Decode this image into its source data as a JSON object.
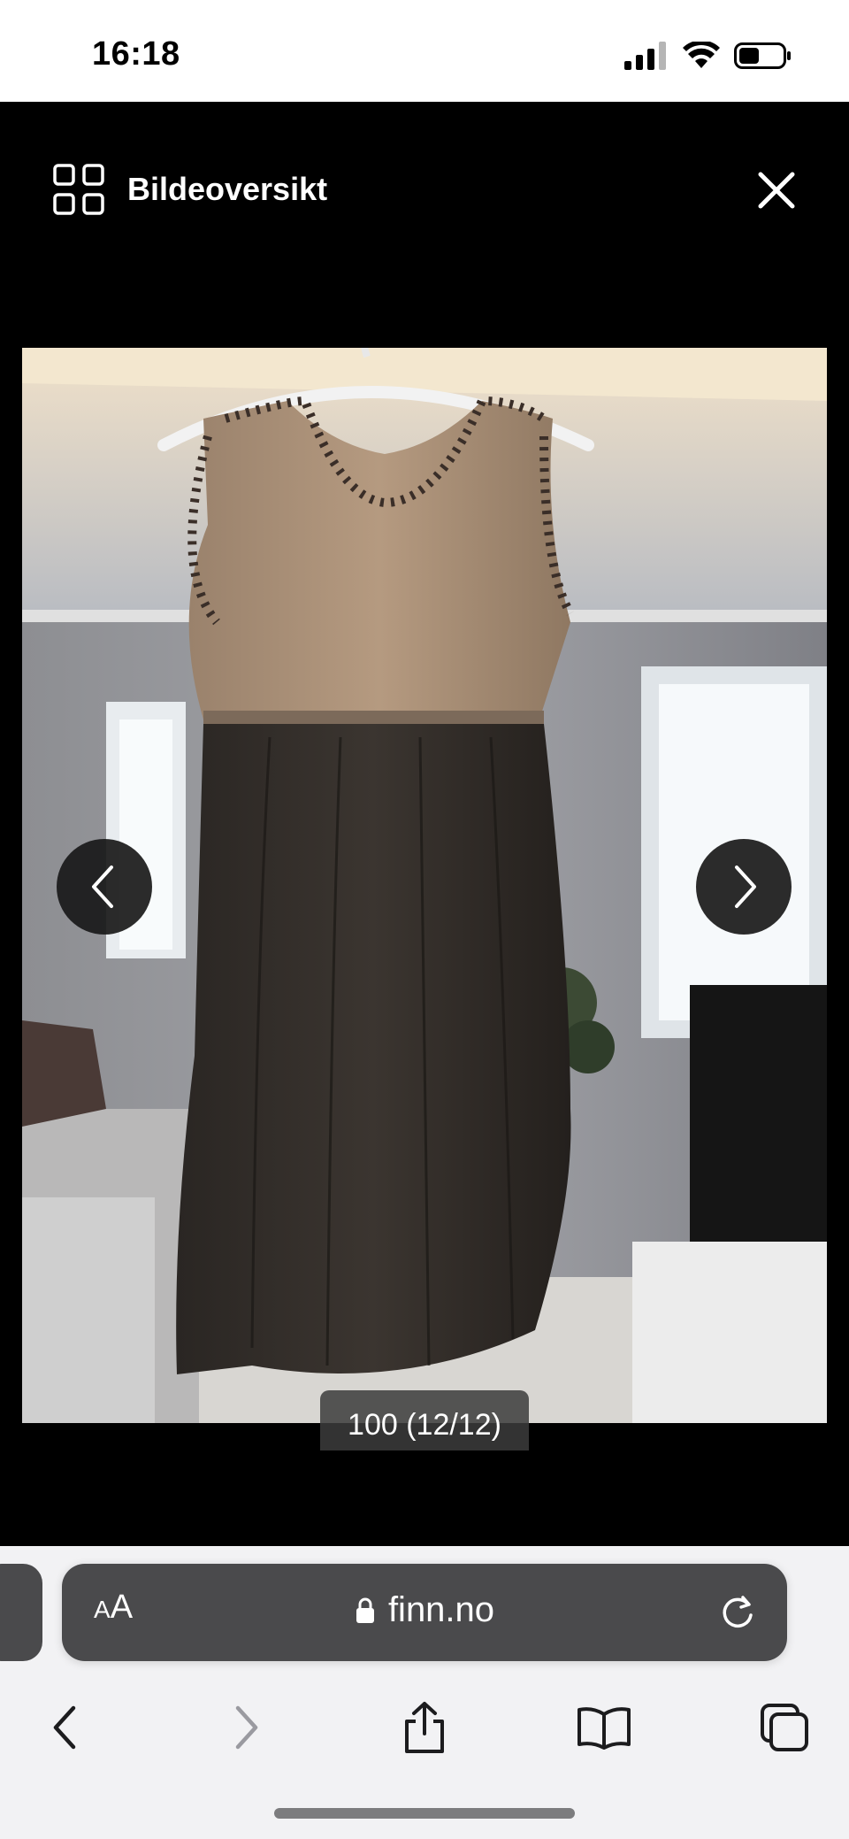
{
  "status_bar": {
    "time": "16:18",
    "icons": [
      "cellular-signal-icon",
      "wifi-icon",
      "battery-icon"
    ]
  },
  "viewer": {
    "overview_label": "Bildeoversikt",
    "icons": {
      "overview": "grid-icon",
      "close": "close-icon",
      "prev": "chevron-left-icon",
      "next": "chevron-right-icon"
    },
    "image_description_colors": {
      "background": "#000000",
      "nav_button": "#191919"
    },
    "counter": "100 (12/12)"
  },
  "browser": {
    "text_size_label_small": "A",
    "text_size_label_large": "A",
    "url": "finn.no",
    "icons": [
      "lock-icon",
      "reload-icon",
      "back-icon",
      "forward-icon",
      "share-icon",
      "bookmarks-icon",
      "tabs-icon"
    ]
  }
}
